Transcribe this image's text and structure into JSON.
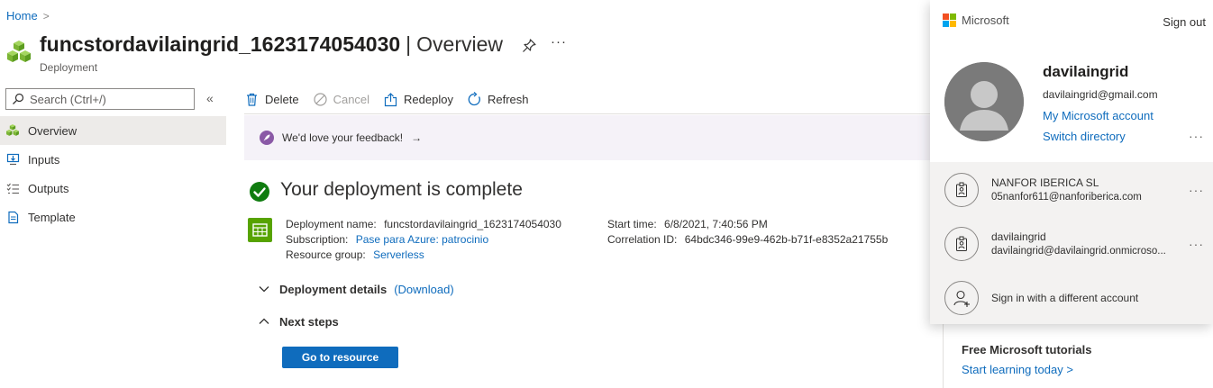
{
  "breadcrumb": {
    "home": "Home",
    "chevron": ">"
  },
  "header": {
    "title": "funcstordavilaingrid_1623174054030",
    "separator": "|",
    "section": "Overview",
    "subtitle": "Deployment",
    "more": "···"
  },
  "sidebar": {
    "search_placeholder": "Search (Ctrl+/)",
    "collapse": "«",
    "items": [
      {
        "label": "Overview",
        "icon": "deployment-cubes-icon"
      },
      {
        "label": "Inputs",
        "icon": "inputs-icon"
      },
      {
        "label": "Outputs",
        "icon": "outputs-icon"
      },
      {
        "label": "Template",
        "icon": "template-icon"
      }
    ]
  },
  "toolbar": {
    "delete": "Delete",
    "cancel": "Cancel",
    "redeploy": "Redeploy",
    "refresh": "Refresh"
  },
  "feedback": {
    "text": "We'd love your feedback!",
    "arrow": "→"
  },
  "deployment": {
    "status": "Your deployment is complete",
    "name_label": "Deployment name:",
    "name_value": "funcstordavilaingrid_1623174054030",
    "subscription_label": "Subscription:",
    "subscription_value": "Pase para Azure: patrocinio",
    "resource_group_label": "Resource group:",
    "resource_group_value": "Serverless",
    "start_time_label": "Start time:",
    "start_time_value": "6/8/2021, 7:40:56 PM",
    "correlation_label": "Correlation ID:",
    "correlation_value": "64bdc346-99e9-462b-b71f-e8352a21755b",
    "details_label": "Deployment details",
    "download_label": "(Download)",
    "next_steps_label": "Next steps",
    "go_button": "Go to resource"
  },
  "right_pane": {
    "tutorials_title": "Free Microsoft tutorials",
    "tutorials_link": "Start learning today >"
  },
  "account_popup": {
    "brand": "Microsoft",
    "sign_out": "Sign out",
    "user_name": "davilaingrid",
    "user_email": "davilaingrid@gmail.com",
    "my_account": "My Microsoft account",
    "switch_directory": "Switch directory",
    "more": "···",
    "accounts": [
      {
        "line1": "NANFOR IBERICA SL",
        "line2": "05nanfor611@nanforiberica.com"
      },
      {
        "line1": "davilaingrid",
        "line2": "davilaingrid@davilaingrid.onmicroso..."
      }
    ],
    "other_account": "Sign in with a different account"
  },
  "colors": {
    "accent": "#0f6cbd",
    "success": "#107c10",
    "feedback_bg": "#f5f2f8",
    "selected_nav": "#edebe9",
    "popup_accounts_bg": "#f3f2f1"
  }
}
